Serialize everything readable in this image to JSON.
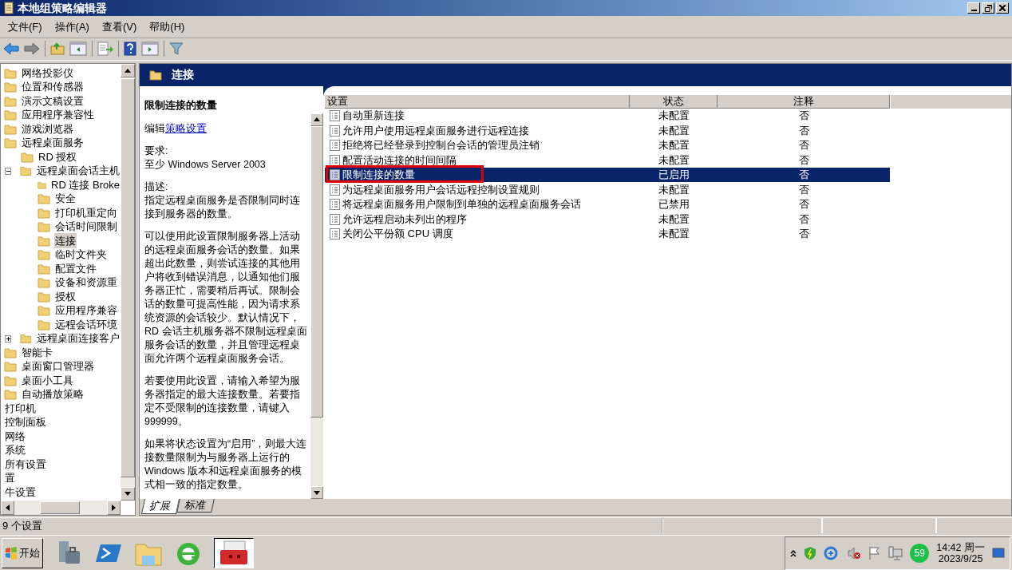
{
  "window": {
    "title": "本地组策略编辑器"
  },
  "menu": [
    "文件(F)",
    "操作(A)",
    "查看(V)",
    "帮助(H)"
  ],
  "tree": [
    {
      "label": "网络投影仪",
      "kind": "folder",
      "selected": false
    },
    {
      "label": "位置和传感器",
      "kind": "folder",
      "selected": false
    },
    {
      "label": "演示文稿设置",
      "kind": "folder",
      "selected": false
    },
    {
      "label": "应用程序兼容性",
      "kind": "folder",
      "selected": false
    },
    {
      "label": "游戏浏览器",
      "kind": "folder",
      "selected": false
    },
    {
      "label": "远程桌面服务",
      "kind": "folder",
      "selected": false,
      "children": [
        {
          "label": "RD 授权",
          "kind": "folder",
          "selected": false
        },
        {
          "label": "远程桌面会话主机",
          "kind": "folder",
          "selected": false,
          "expanded": true,
          "children": [
            {
              "label": "RD 连接 Broke",
              "kind": "folder",
              "selected": false
            },
            {
              "label": "安全",
              "kind": "folder",
              "selected": false
            },
            {
              "label": "打印机重定向",
              "kind": "folder",
              "selected": false
            },
            {
              "label": "会话时间限制",
              "kind": "folder",
              "selected": false
            },
            {
              "label": "连接",
              "kind": "folder",
              "selected": true
            },
            {
              "label": "临时文件夹",
              "kind": "folder",
              "selected": false
            },
            {
              "label": "配置文件",
              "kind": "folder",
              "selected": false
            },
            {
              "label": "设备和资源重",
              "kind": "folder",
              "selected": false
            },
            {
              "label": "授权",
              "kind": "folder",
              "selected": false
            },
            {
              "label": "应用程序兼容",
              "kind": "folder",
              "selected": false
            },
            {
              "label": "远程会话环境",
              "kind": "folder",
              "selected": false
            }
          ]
        },
        {
          "label": "远程桌面连接客户",
          "kind": "folder",
          "selected": false,
          "expanded": false
        }
      ]
    },
    {
      "label": "智能卡",
      "kind": "folder",
      "selected": false
    },
    {
      "label": "桌面窗口管理器",
      "kind": "folder",
      "selected": false
    },
    {
      "label": "桌面小工具",
      "kind": "folder",
      "selected": false
    },
    {
      "label": "自动播放策略",
      "kind": "folder",
      "selected": false
    },
    {
      "label": "打印机",
      "kind": "plain",
      "selected": false
    },
    {
      "label": "控制面板",
      "kind": "plain",
      "selected": false
    },
    {
      "label": "网络",
      "kind": "plain",
      "selected": false
    },
    {
      "label": "系统",
      "kind": "plain",
      "selected": false
    },
    {
      "label": "所有设置",
      "kind": "plain",
      "selected": false
    },
    {
      "label": "置",
      "kind": "plain",
      "selected": false
    },
    {
      "label": "牛设置",
      "kind": "plain",
      "selected": false
    }
  ],
  "header": {
    "title": "连接"
  },
  "description": {
    "title": "限制连接的数量",
    "edit_prefix": "编辑",
    "edit_link": "策略设置",
    "paragraphs": [
      "要求:\n至少 Windows Server 2003",
      "描述:\n指定远程桌面服务是否限制同时连接到服务器的数量。",
      "可以使用此设置限制服务器上活动的远程桌面服务会话的数量。如果超出此数量，则尝试连接的其他用户将收到错误消息，以通知他们服务器正忙，需要稍后再试。限制会话的数量可提高性能，因为请求系统资源的会话较少。默认情况下，RD 会话主机服务器不限制远程桌面服务会话的数量，并且管理远程桌面允许两个远程桌面服务会话。",
      "若要使用此设置，请输入希望为服务器指定的最大连接数量。若要指定不受限制的连接数量，请键入 999999。",
      "如果将状态设置为“启用”，则最大连接数量限制为与服务器上运行的 Windows 版本和远程桌面服务的模式相一致的指定数量。"
    ]
  },
  "table": {
    "columns": [
      "设置",
      "状态",
      "注释"
    ],
    "rows": [
      {
        "setting": "自动重新连接",
        "state": "未配置",
        "comment": "否",
        "selected": false,
        "annotated": false
      },
      {
        "setting": "允许用户使用远程桌面服务进行远程连接",
        "state": "未配置",
        "comment": "否",
        "selected": false,
        "annotated": false
      },
      {
        "setting": "拒绝将已经登录到控制台会话的管理员注销",
        "state": "未配置",
        "comment": "否",
        "selected": false,
        "annotated": false
      },
      {
        "setting": "配置活动连接的时间间隔",
        "state": "未配置",
        "comment": "否",
        "selected": false,
        "annotated": false
      },
      {
        "setting": "限制连接的数量",
        "state": "已启用",
        "comment": "否",
        "selected": true,
        "annotated": true
      },
      {
        "setting": "为远程桌面服务用户会话远程控制设置规则",
        "state": "未配置",
        "comment": "否",
        "selected": false,
        "annotated": false
      },
      {
        "setting": "将远程桌面服务用户限制到单独的远程桌面服务会话",
        "state": "已禁用",
        "comment": "否",
        "selected": false,
        "annotated": false
      },
      {
        "setting": "允许远程启动未列出的程序",
        "state": "未配置",
        "comment": "否",
        "selected": false,
        "annotated": false
      },
      {
        "setting": "关闭公平份额 CPU 调度",
        "state": "未配置",
        "comment": "否",
        "selected": false,
        "annotated": false
      }
    ]
  },
  "view_tabs": [
    {
      "label": "扩展",
      "selected": true
    },
    {
      "label": "标准",
      "selected": false
    }
  ],
  "status_bar": "9 个设置",
  "taskbar": {
    "start": "开始",
    "tray_badge": "59",
    "time": "14:42 周一",
    "date": "2023/9/25"
  }
}
